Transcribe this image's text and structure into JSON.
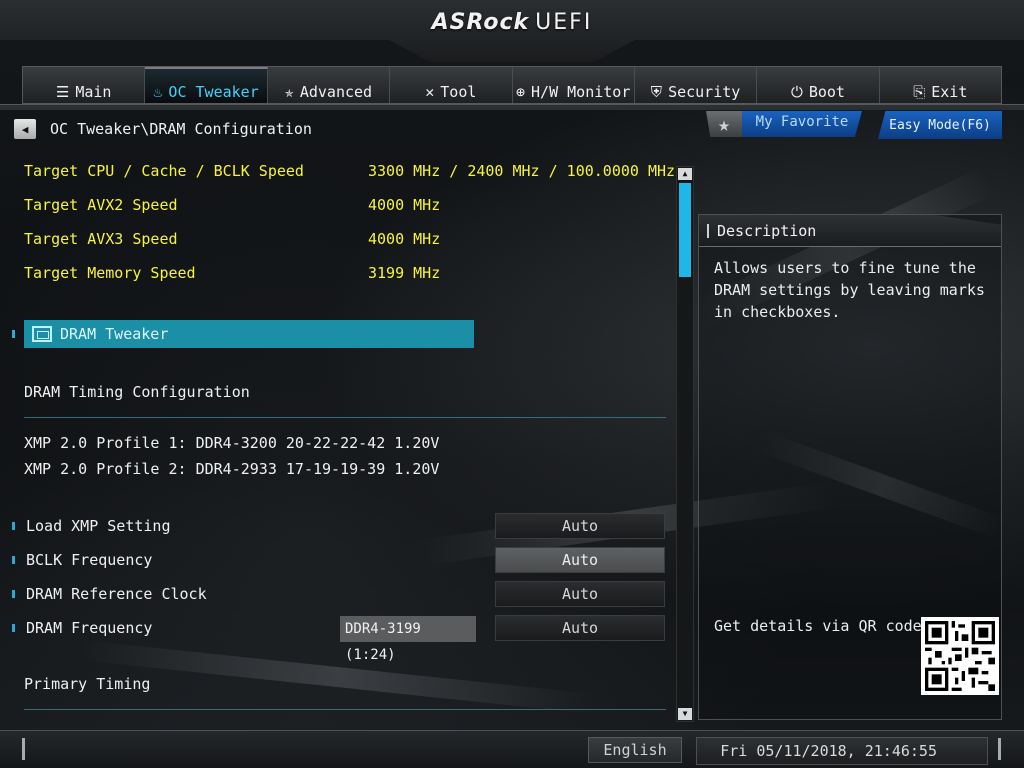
{
  "header": {
    "brand": "ASRock",
    "product": "UEFI"
  },
  "tabs": [
    {
      "label": "Main",
      "icon": "list-icon"
    },
    {
      "label": "OC Tweaker",
      "icon": "flame-icon",
      "active": true
    },
    {
      "label": "Advanced",
      "icon": "star-icon"
    },
    {
      "label": "Tool",
      "icon": "tools-icon"
    },
    {
      "label": "H/W Monitor",
      "icon": "monitor-icon"
    },
    {
      "label": "Security",
      "icon": "shield-icon"
    },
    {
      "label": "Boot",
      "icon": "power-icon"
    },
    {
      "label": "Exit",
      "icon": "exit-icon"
    }
  ],
  "breadcrumb": "OC Tweaker\\DRAM Configuration",
  "favorite": {
    "label": "My Favorite"
  },
  "easy_mode": {
    "label": "Easy Mode(F6)"
  },
  "targets": [
    {
      "label": "Target CPU / Cache / BCLK Speed",
      "value": "3300 MHz / 2400 MHz / 100.0000 MHz"
    },
    {
      "label": "Target AVX2 Speed",
      "value": "4000 MHz"
    },
    {
      "label": "Target AVX3 Speed",
      "value": "4000 MHz"
    },
    {
      "label": "Target Memory Speed",
      "value": "3199 MHz"
    }
  ],
  "dram_tweaker": {
    "label": "DRAM Tweaker"
  },
  "timing_section": {
    "label": "DRAM Timing Configuration"
  },
  "xmp_profiles": [
    "XMP 2.0 Profile 1: DDR4-3200 20-22-22-42 1.20V",
    "XMP 2.0 Profile 2: DDR4-2933 17-19-19-39 1.20V"
  ],
  "settings": [
    {
      "label": "Load XMP Setting",
      "value": "Auto"
    },
    {
      "label": "BCLK Frequency",
      "value": "Auto",
      "selected": true
    },
    {
      "label": "DRAM Reference Clock",
      "value": "Auto"
    },
    {
      "label": "DRAM Frequency",
      "value": "Auto",
      "current": "DDR4-3199 (1:24)"
    }
  ],
  "primary_timing": {
    "label": "Primary Timing"
  },
  "description": {
    "title": "Description",
    "text": "Allows users to fine tune the DRAM settings by leaving marks in checkboxes.",
    "qr_label": "Get details via QR code"
  },
  "footer": {
    "language": "English",
    "datetime": "Fri 05/11/2018, 21:46:55"
  },
  "colors": {
    "accent": "#1fb6e8",
    "target_text": "#f7f43a",
    "highlight": "#1a8fa6"
  }
}
